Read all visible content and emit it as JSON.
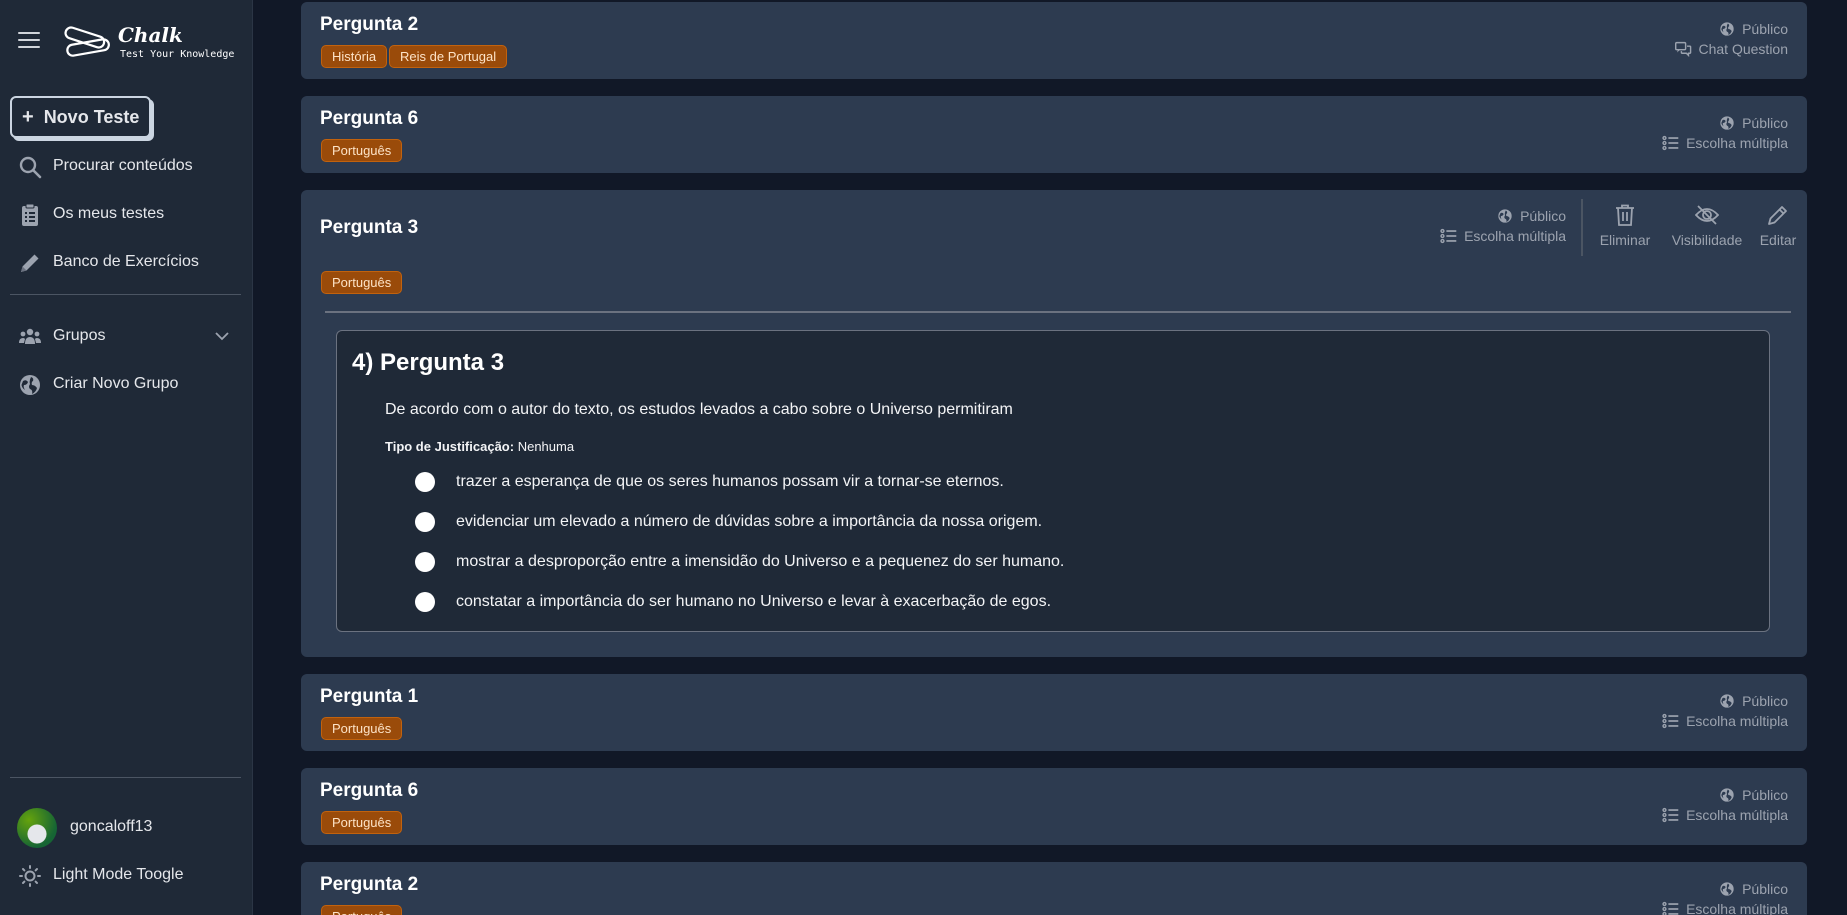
{
  "sidebar": {
    "logo": {
      "title": "Chalk",
      "subtitle": "Test Your Knowledge"
    },
    "new_test_label": "Novo Teste",
    "nav": [
      {
        "label": "Procurar conteúdos",
        "icon": "search-icon"
      },
      {
        "label": "Os meus testes",
        "icon": "clipboard-icon"
      },
      {
        "label": "Banco de Exercícios",
        "icon": "pencil-icon"
      }
    ],
    "groups_label": "Grupos",
    "create_group_label": "Criar Novo Grupo",
    "username": "goncaloff13",
    "theme_toggle_label": "Light Mode Toogle"
  },
  "cards": [
    {
      "title": "Pergunta 2",
      "tags": [
        "História",
        "Reis de Portugal"
      ],
      "visibility": "Público",
      "type": "Chat Question",
      "type_icon": "chat-icon"
    },
    {
      "title": "Pergunta 6",
      "tags": [
        "Português"
      ],
      "visibility": "Público",
      "type": "Escolha múltipla",
      "type_icon": "list-icon"
    },
    {
      "title": "Pergunta 3",
      "tags": [
        "Português"
      ],
      "visibility": "Público",
      "type": "Escolha múltipla",
      "type_icon": "list-icon",
      "actions": {
        "delete": "Eliminar",
        "visibility": "Visibilidade",
        "edit": "Editar"
      },
      "detail": {
        "heading": "4) Pergunta 3",
        "text": "De acordo com o autor do texto, os estudos levados a cabo sobre o Universo permitiram",
        "justification_label": "Tipo de Justificação:",
        "justification_value": "Nenhuma",
        "options": [
          "trazer a esperança de que os seres humanos possam vir a tornar-se eternos.",
          "evidenciar um elevado a número de dúvidas sobre a importância da nossa origem.",
          "mostrar a desproporção entre a imensidão do Universo e a pequenez do ser humano.",
          "constatar a importância do ser humano no Universo e levar à exacerbação de egos."
        ]
      }
    },
    {
      "title": "Pergunta 1",
      "tags": [
        "Português"
      ],
      "visibility": "Público",
      "type": "Escolha múltipla",
      "type_icon": "list-icon"
    },
    {
      "title": "Pergunta 6",
      "tags": [
        "Português"
      ],
      "visibility": "Público",
      "type": "Escolha múltipla",
      "type_icon": "list-icon"
    },
    {
      "title": "Pergunta 2",
      "tags": [
        "Português"
      ],
      "visibility": "Público",
      "type": "Escolha múltipla",
      "type_icon": "list-icon"
    }
  ],
  "colors": {
    "sidebar_bg": "#1f2937",
    "card_bg": "#2d3b50",
    "page_bg": "#111827",
    "tag_bg": "#9a4b0a"
  }
}
